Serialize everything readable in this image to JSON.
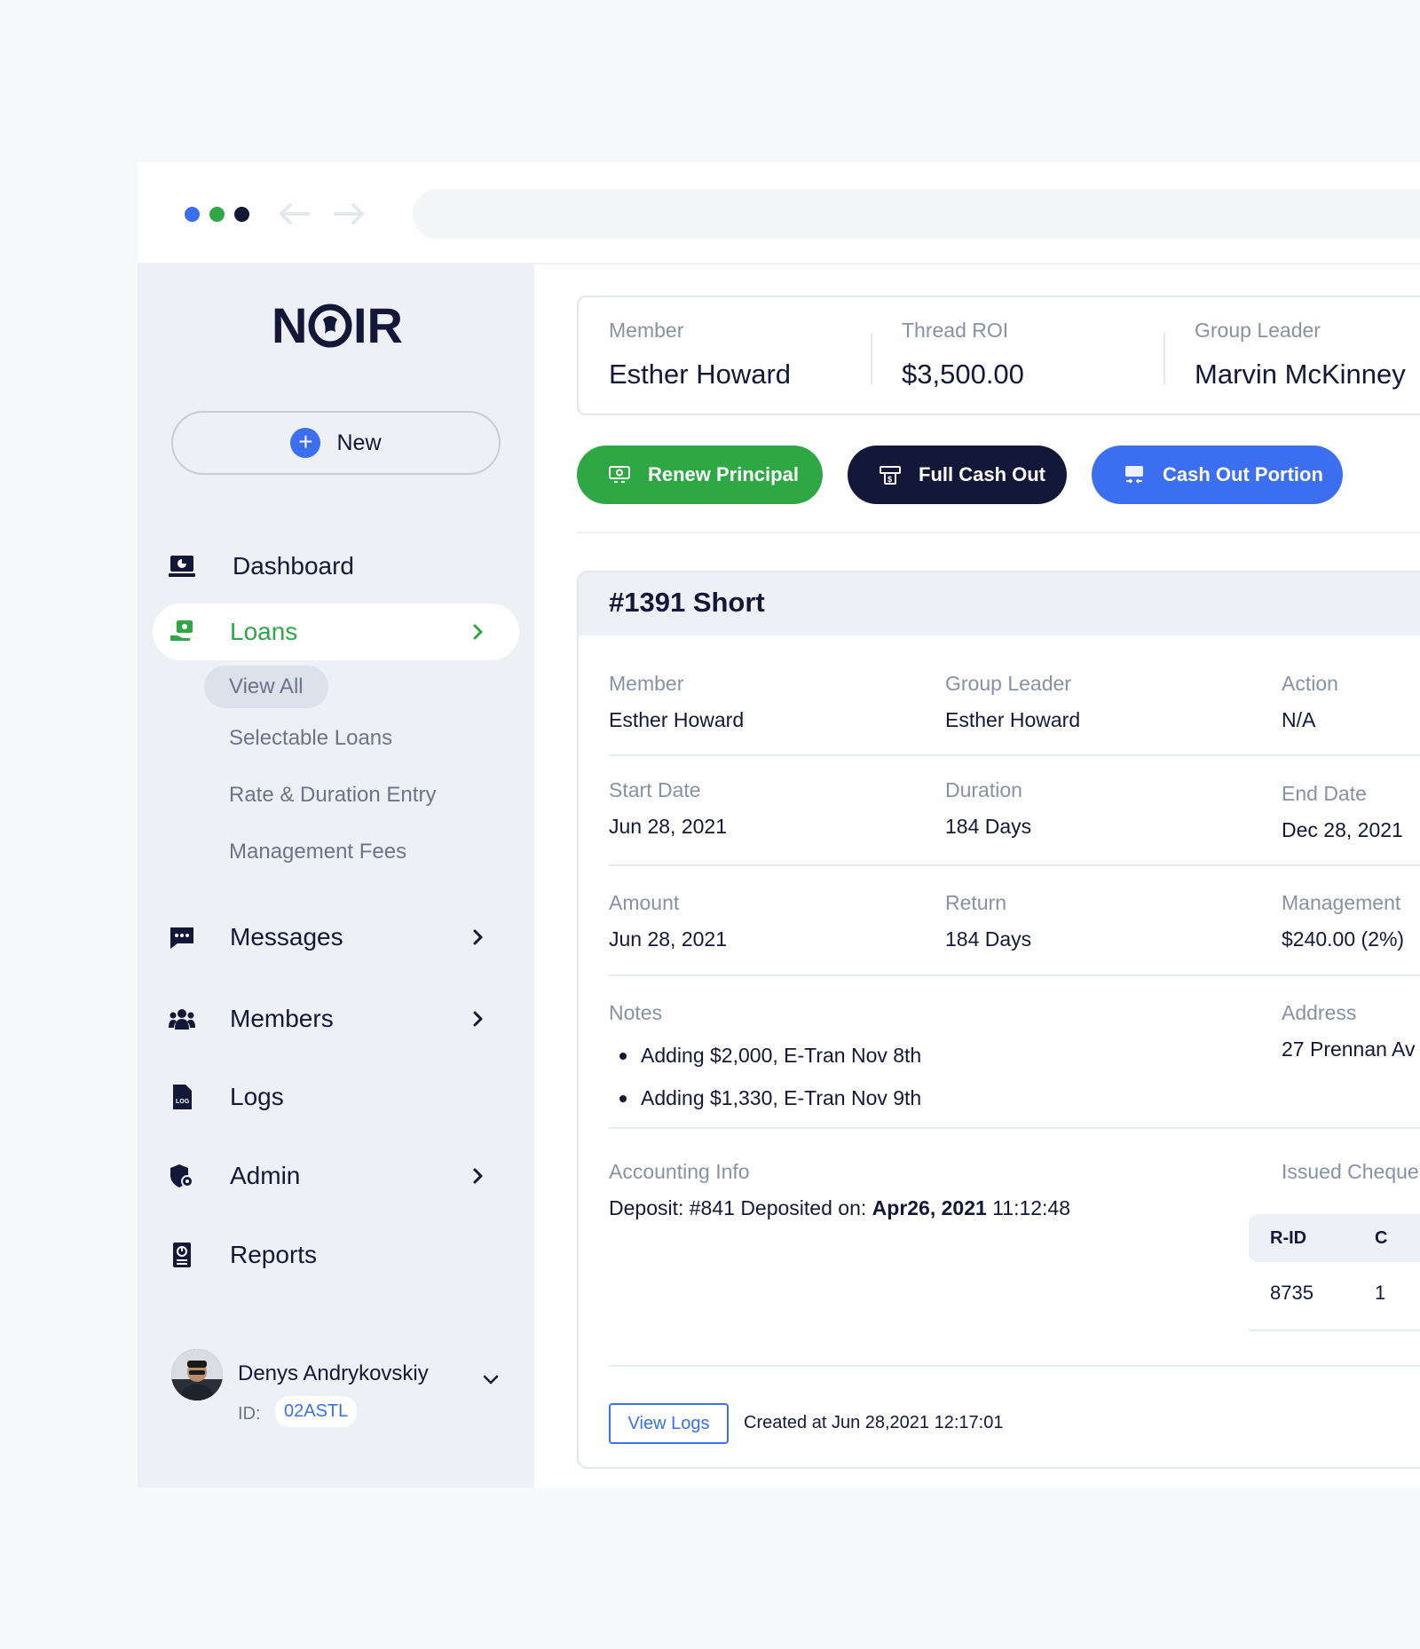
{
  "brand": {
    "logo_text": "NOIR"
  },
  "sidebar": {
    "new_label": "New",
    "items": [
      {
        "label": "Dashboard"
      },
      {
        "label": "Loans"
      },
      {
        "label": "Messages"
      },
      {
        "label": "Members"
      },
      {
        "label": "Logs"
      },
      {
        "label": "Admin"
      },
      {
        "label": "Reports"
      }
    ],
    "loans_sub": [
      {
        "label": "View All"
      },
      {
        "label": "Selectable Loans"
      },
      {
        "label": "Rate & Duration Entry"
      },
      {
        "label": "Management Fees"
      }
    ],
    "user": {
      "name": "Denys Andrykovskiy",
      "id_label": "ID:",
      "id_value": "02ASTL"
    }
  },
  "summary": {
    "member_label": "Member",
    "member_value": "Esther Howard",
    "roi_label": "Thread ROI",
    "roi_value": "$3,500.00",
    "leader_label": "Group Leader",
    "leader_value": "Marvin McKinney"
  },
  "actions": {
    "renew": "Renew Principal",
    "full": "Full Cash Out",
    "portion": "Cash Out Portion"
  },
  "loan": {
    "title": "#1391 Short",
    "member_label": "Member",
    "member_value": "Esther Howard",
    "leader_label": "Group Leader",
    "leader_value": "Esther Howard",
    "action_label": "Action",
    "action_value": "N/A",
    "start_label": "Start Date",
    "start_value": "Jun 28, 2021",
    "duration_label": "Duration",
    "duration_value": "184 Days",
    "end_label": "End Date",
    "end_value": "Dec 28, 2021",
    "amount_label": "Amount",
    "amount_value": "Jun 28, 2021",
    "return_label": "Return",
    "return_value": "184 Days",
    "mgmt_label": "Management",
    "mgmt_value": "$240.00 (2%)",
    "notes_label": "Notes",
    "notes": [
      "Adding $2,000, E-Tran Nov 8th",
      "Adding $1,330, E-Tran Nov 9th"
    ],
    "address_label": "Address",
    "address_value": "27 Prennan Av",
    "accounting_label": "Accounting Info",
    "accounting_prefix": "Deposit: #841 Deposited on: ",
    "accounting_date": "Apr26, 2021",
    "accounting_time": " 11:12:48",
    "cheques_label": "Issued Cheque",
    "cheques_cols": [
      "R-ID",
      "C"
    ],
    "cheques_rows": [
      [
        "8735",
        "1"
      ]
    ],
    "view_logs": "View Logs",
    "created": "Created at Jun 28,2021 12:17:01"
  },
  "colors": {
    "green": "#2ea845",
    "navy": "#141838",
    "blue": "#3b6ff0"
  }
}
